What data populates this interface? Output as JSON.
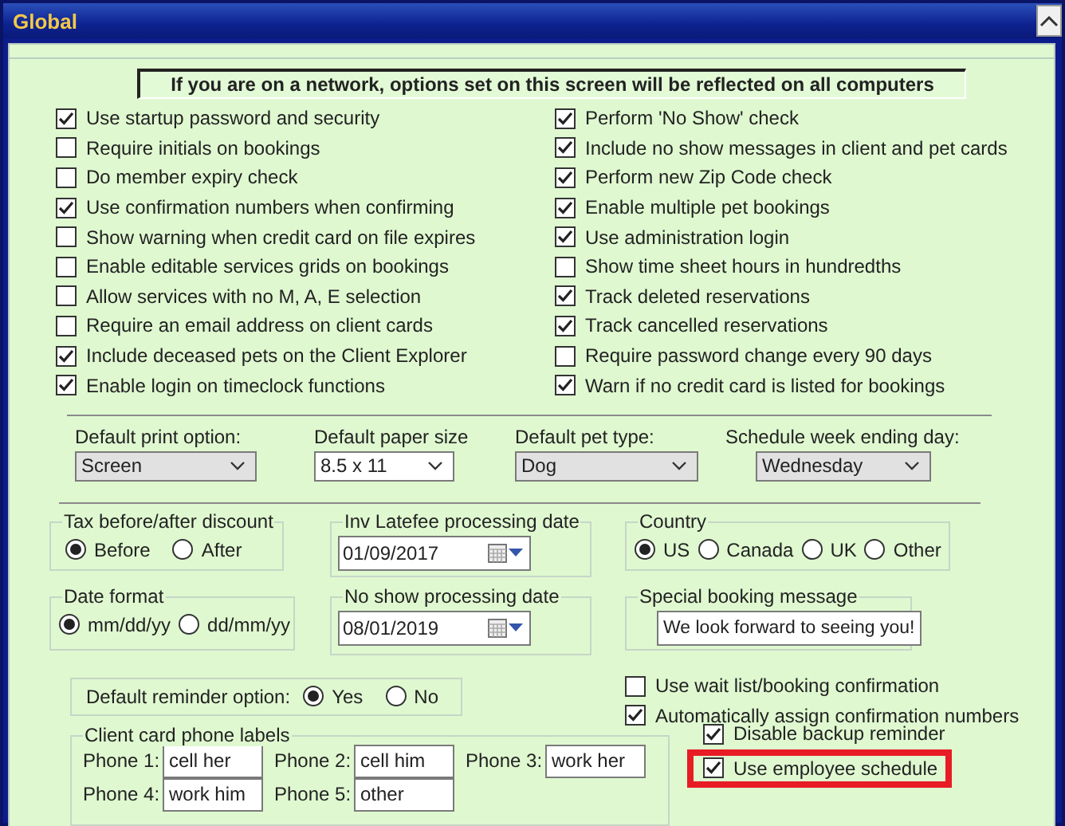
{
  "window": {
    "title": "Global"
  },
  "banner": "If you are on a network, options set on this screen will be reflected on all computers",
  "options_left": [
    {
      "label": "Use startup password and security",
      "checked": true
    },
    {
      "label": "Require initials on bookings",
      "checked": false
    },
    {
      "label": "Do member expiry check",
      "checked": false
    },
    {
      "label": "Use confirmation numbers when confirming",
      "checked": true
    },
    {
      "label": "Show warning when credit card on file expires",
      "checked": false
    },
    {
      "label": "Enable editable services grids on bookings",
      "checked": false
    },
    {
      "label": "Allow services with no M, A, E selection",
      "checked": false
    },
    {
      "label": "Require an email address on client cards",
      "checked": false
    },
    {
      "label": "Include deceased pets on the Client Explorer",
      "checked": true
    },
    {
      "label": "Enable login on timeclock functions",
      "checked": true
    }
  ],
  "options_right": [
    {
      "label": "Perform 'No Show' check",
      "checked": true
    },
    {
      "label": "Include no show messages in client and pet cards",
      "checked": true
    },
    {
      "label": "Perform new Zip Code check",
      "checked": true
    },
    {
      "label": "Enable multiple pet bookings",
      "checked": true
    },
    {
      "label": "Use administration login",
      "checked": true
    },
    {
      "label": "Show time sheet hours in hundredths",
      "checked": false
    },
    {
      "label": "Track deleted reservations",
      "checked": true
    },
    {
      "label": "Track cancelled reservations",
      "checked": true
    },
    {
      "label": "Require password change every 90 days",
      "checked": false
    },
    {
      "label": "Warn if no credit card is listed for bookings",
      "checked": true
    }
  ],
  "dropdowns": [
    {
      "label": "Default print option:",
      "value": "Screen",
      "kind": "list"
    },
    {
      "label": "Default paper size",
      "value": "8.5 x 11",
      "kind": "combo"
    },
    {
      "label": "Default pet type:",
      "value": "Dog",
      "kind": "list"
    },
    {
      "label": "Schedule week ending day:",
      "value": "Wednesday",
      "kind": "list"
    }
  ],
  "tax": {
    "label": "Tax before/after discount",
    "options": [
      {
        "label": "Before",
        "selected": true
      },
      {
        "label": "After",
        "selected": false
      }
    ]
  },
  "inv_latefee": {
    "label": "Inv Latefee processing date",
    "value": "01/09/2017"
  },
  "country": {
    "label": "Country",
    "options": [
      {
        "label": "US",
        "selected": true
      },
      {
        "label": "Canada",
        "selected": false
      },
      {
        "label": "UK",
        "selected": false
      },
      {
        "label": "Other",
        "selected": false
      }
    ]
  },
  "date_format": {
    "label": "Date format",
    "options": [
      {
        "label": "mm/dd/yy",
        "selected": true
      },
      {
        "label": "dd/mm/yy",
        "selected": false
      }
    ]
  },
  "no_show_date": {
    "label": "No show processing date",
    "value": "08/01/2019"
  },
  "special_message": {
    "label": "Special booking message",
    "value": "We look forward to seeing you!"
  },
  "reminder": {
    "label": "Default reminder option:",
    "options": [
      {
        "label": "Yes",
        "selected": true
      },
      {
        "label": "No",
        "selected": false
      }
    ]
  },
  "booking_options": [
    {
      "label": "Use wait list/booking confirmation",
      "checked": false
    },
    {
      "label": "Automatically assign confirmation numbers",
      "checked": true
    }
  ],
  "phone_labels": {
    "label": "Client card phone labels",
    "phones": [
      {
        "label": "Phone 1:",
        "value": "cell her"
      },
      {
        "label": "Phone 2:",
        "value": "cell him"
      },
      {
        "label": "Phone 3:",
        "value": "work her"
      },
      {
        "label": "Phone 4:",
        "value": "work him"
      },
      {
        "label": "Phone 5:",
        "value": "other"
      }
    ]
  },
  "extra_options": [
    {
      "label": "Disable backup reminder",
      "checked": true,
      "highlighted": false
    },
    {
      "label": "Use employee schedule",
      "checked": true,
      "highlighted": true
    }
  ]
}
